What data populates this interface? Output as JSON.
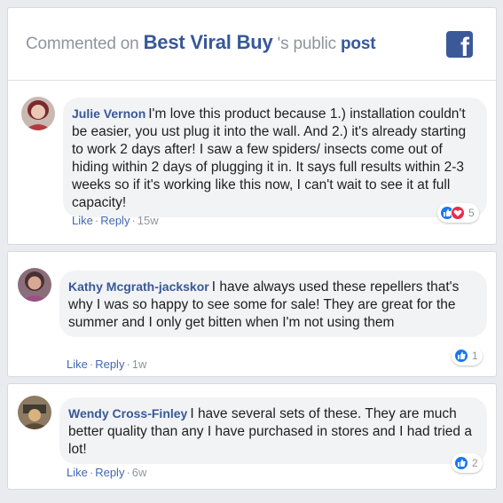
{
  "header": {
    "prefix": "Commented on",
    "page_name": "Best Viral Buy",
    "suffix": "'s public",
    "post_link": "post"
  },
  "comments": [
    {
      "author": "Julie Vernon",
      "text": "I'm love this product because 1.) installation couldn't be easier, you ust plug it into the wall. And 2.) it's already starting to work 2 days after! I saw a few spiders/ insects come out of hiding within 2 days of plugging it in. It says full results within 2-3 weeks so if it's working like this now, I can't wait to see it at full capacity!",
      "like_label": "Like",
      "reply_label": "Reply",
      "time": "15w",
      "reaction_count": "5",
      "reactions": [
        "like",
        "love"
      ]
    },
    {
      "author": "Kathy Mcgrath-jackskor",
      "text": "I have always used these repellers that's why I was so happy to see some for sale! They are great for the summer and I only get bitten when I'm not using them",
      "like_label": "Like",
      "reply_label": "Reply",
      "time": "1w",
      "reaction_count": "1",
      "reactions": [
        "like"
      ]
    },
    {
      "author": "Wendy Cross-Finley",
      "text": "I have several sets of these. They are much better quality than any I have purchased in stores and I had tried a lot!",
      "like_label": "Like",
      "reply_label": "Reply",
      "time": "6w",
      "reaction_count": "2",
      "reactions": [
        "like"
      ]
    }
  ],
  "colors": {
    "facebook_blue": "#3b5998",
    "link_blue": "#365899",
    "bubble_gray": "#f2f3f5",
    "like_blue": "#1877f2",
    "love_red": "#f0284a"
  }
}
